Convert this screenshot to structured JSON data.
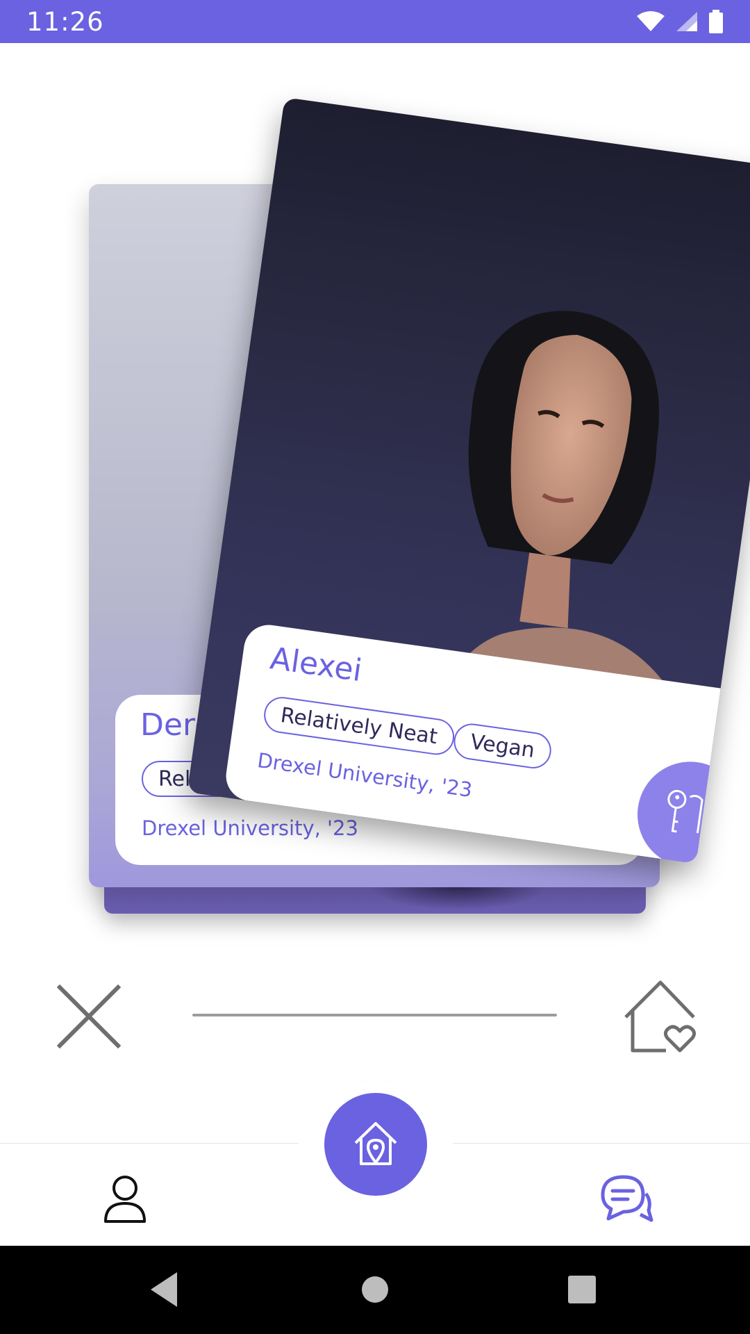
{
  "status_bar": {
    "time": "11:26",
    "icons": [
      "wifi-icon",
      "signal-icon",
      "battery-icon"
    ],
    "color": "#6a62e0"
  },
  "back_card": {
    "name": "Derek",
    "tags": [
      "Relative"
    ],
    "school": "Drexel University, '23"
  },
  "front_card": {
    "name": "Alexei",
    "tags": [
      "Relatively Neat",
      "Vegan"
    ],
    "school": "Drexel University, '23",
    "action_icon": "keys-icon"
  },
  "actions": {
    "reject_icon": "close-icon",
    "like_icon": "house-heart-icon"
  },
  "bottom_nav": {
    "items": [
      "profile-icon",
      "home-location-icon",
      "chat-icon"
    ],
    "accent": "#6a62e0"
  },
  "system_nav": {
    "items": [
      "back-icon",
      "home-circle-icon",
      "recents-icon"
    ]
  }
}
